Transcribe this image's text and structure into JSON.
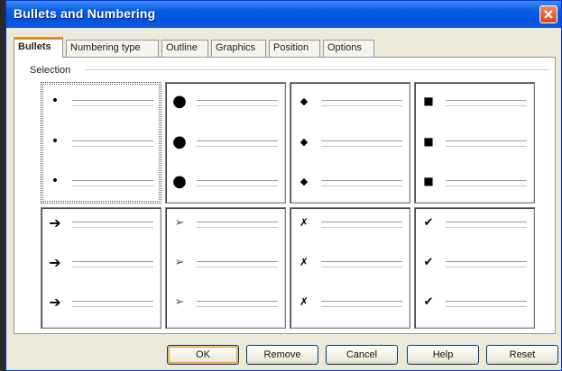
{
  "dialog": {
    "title": "Bullets and Numbering",
    "close_icon": "close-icon"
  },
  "tabs": [
    {
      "label": "Bullets",
      "active": true
    },
    {
      "label": "Numbering type",
      "active": false
    },
    {
      "label": "Outline",
      "active": false
    },
    {
      "label": "Graphics",
      "active": false
    },
    {
      "label": "Position",
      "active": false
    },
    {
      "label": "Options",
      "active": false
    }
  ],
  "selection": {
    "label": "Selection",
    "bullet_styles": [
      {
        "icon": "small-dot-bullet-icon",
        "glyph": "•",
        "selected": true
      },
      {
        "icon": "large-dot-bullet-icon",
        "glyph": "●",
        "selected": false
      },
      {
        "icon": "diamond-bullet-icon",
        "glyph": "◆",
        "selected": false
      },
      {
        "icon": "square-bullet-icon",
        "glyph": "■",
        "selected": false
      },
      {
        "icon": "arrow-bullet-icon",
        "glyph": "➔",
        "selected": false
      },
      {
        "icon": "arrowhead-bullet-icon",
        "glyph": "➢",
        "selected": false
      },
      {
        "icon": "cross-bullet-icon",
        "glyph": "✗",
        "selected": false
      },
      {
        "icon": "checkmark-bullet-icon",
        "glyph": "✔",
        "selected": false
      }
    ]
  },
  "buttons": {
    "ok": "OK",
    "remove": "Remove",
    "cancel": "Cancel",
    "help": "Help",
    "reset": "Reset"
  },
  "colors": {
    "titlebar": "#0054e3",
    "dialog_bg": "#ece9d8",
    "active_tab_accent": "#e68b2c"
  }
}
